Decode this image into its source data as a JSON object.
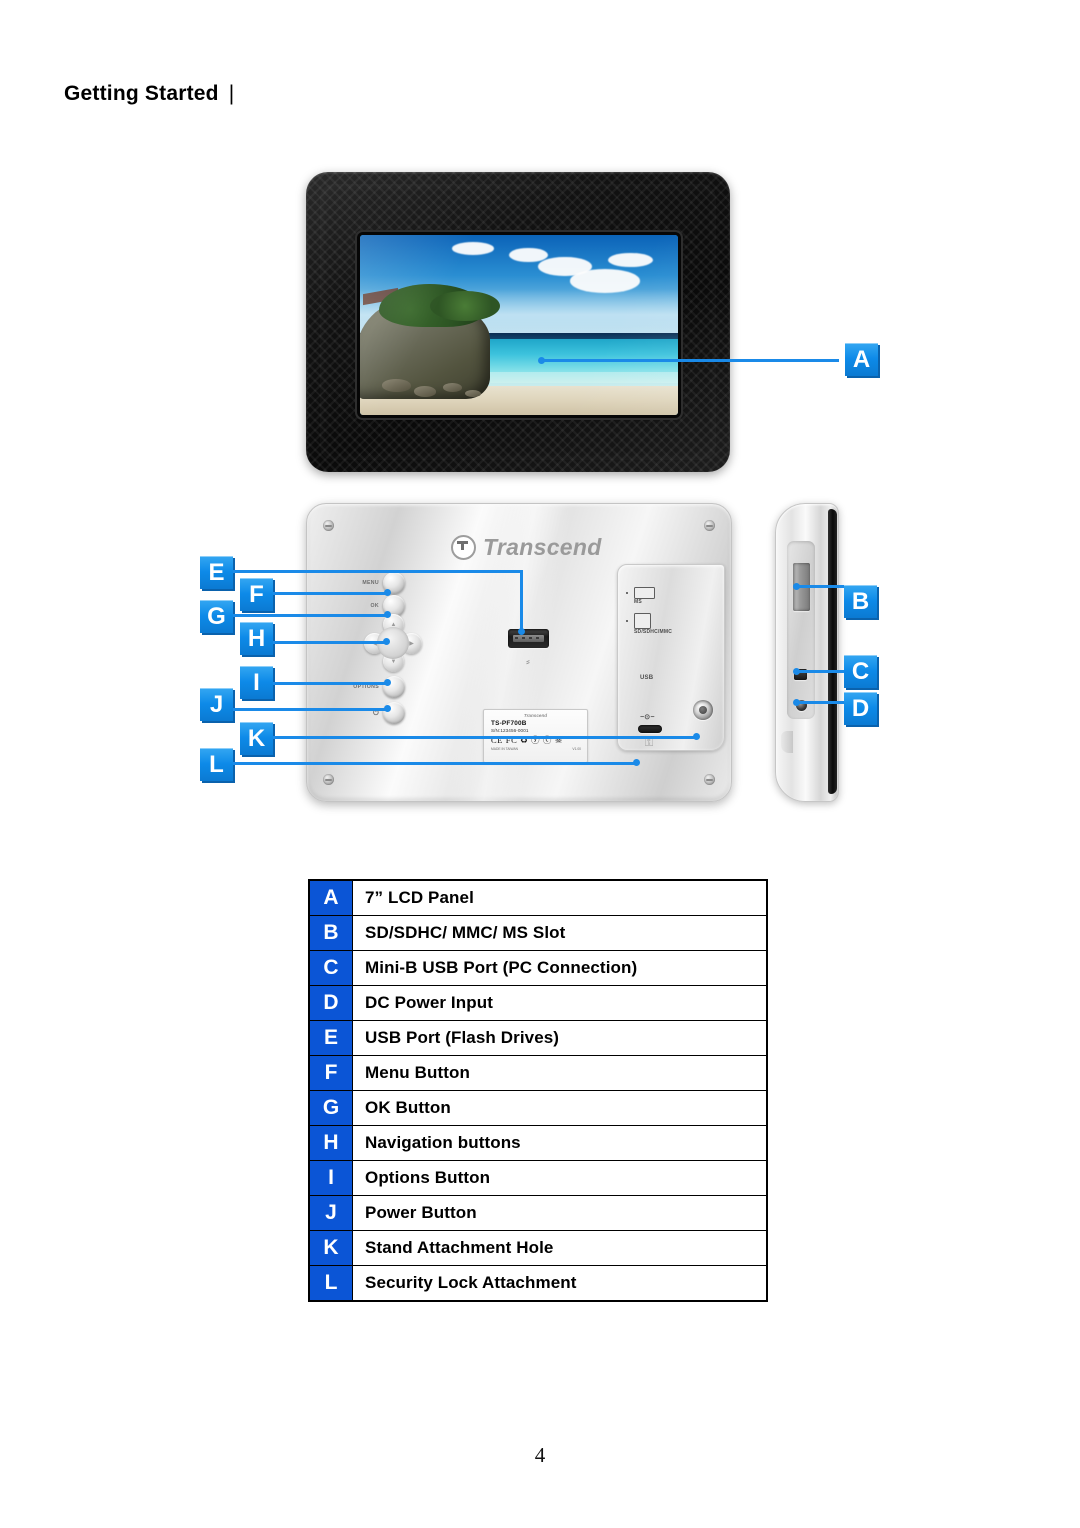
{
  "header": {
    "title": "Getting Started",
    "divider": "|"
  },
  "page_number": "4",
  "front_view": {
    "name": "front-view-photo-frame",
    "screen_image_description": "beach"
  },
  "back_view": {
    "brand": "Transcend",
    "buttons": [
      {
        "key": "F",
        "caption": "MENU"
      },
      {
        "key": "G",
        "caption": "OK"
      },
      {
        "key": "I",
        "caption": "OPTIONS"
      },
      {
        "key": "J",
        "caption": "⏻"
      }
    ],
    "dpad": {
      "up": "▲",
      "down": "▼",
      "left": "◀",
      "right": "▶"
    },
    "usb_symbol": "⸗",
    "slot_panel": {
      "ms_label": "MS",
      "sd_label": "SD/SDHC/MMC",
      "usb_label": "USB",
      "dc_label": "−⊙−"
    },
    "sticker": {
      "logo": "Transcend",
      "model": "TS-PF700B",
      "serial": "S/N:123456-0001",
      "marks": "CE FC ♻ ⓨ ⓒ ☠",
      "foot_left": "MADE IN TAIWAN",
      "foot_right": "V1.00"
    },
    "lock_glyph": "⚿"
  },
  "callouts": [
    {
      "letter": "A",
      "target": "lcd-panel"
    },
    {
      "letter": "B",
      "target": "card-slot"
    },
    {
      "letter": "C",
      "target": "mini-usb-port"
    },
    {
      "letter": "D",
      "target": "dc-power-input"
    },
    {
      "letter": "E",
      "target": "usb-port"
    },
    {
      "letter": "F",
      "target": "menu-button"
    },
    {
      "letter": "G",
      "target": "ok-button"
    },
    {
      "letter": "H",
      "target": "navigation-buttons"
    },
    {
      "letter": "I",
      "target": "options-button"
    },
    {
      "letter": "J",
      "target": "power-button"
    },
    {
      "letter": "K",
      "target": "stand-attachment-hole"
    },
    {
      "letter": "L",
      "target": "security-lock-attachment"
    }
  ],
  "spec_table": {
    "rows": [
      {
        "letter": "A",
        "description": "7” LCD Panel"
      },
      {
        "letter": "B",
        "description": "SD/SDHC/ MMC/ MS Slot"
      },
      {
        "letter": "C",
        "description": "Mini-B USB Port (PC Connection)"
      },
      {
        "letter": "D",
        "description": "DC Power Input"
      },
      {
        "letter": "E",
        "description": "USB Port (Flash Drives)"
      },
      {
        "letter": "F",
        "description": "Menu Button"
      },
      {
        "letter": "G",
        "description": "OK Button"
      },
      {
        "letter": "H",
        "description": "Navigation buttons"
      },
      {
        "letter": "I",
        "description": "Options Button"
      },
      {
        "letter": "J",
        "description": "Power Button"
      },
      {
        "letter": "K",
        "description": "Stand Attachment Hole"
      },
      {
        "letter": "L",
        "description": "Security Lock Attachment"
      }
    ]
  },
  "colors": {
    "callout_blue": "#0d8ae8",
    "callout_shadow": "#0a62ad",
    "table_blue": "#0b55d6",
    "leader_line": "#1a8ae8"
  }
}
